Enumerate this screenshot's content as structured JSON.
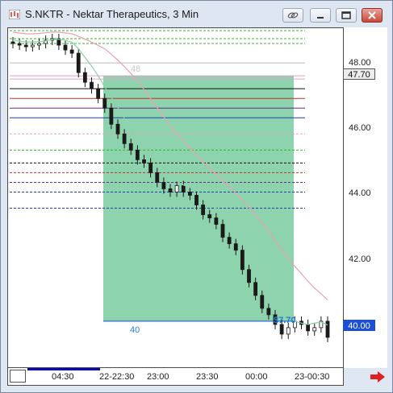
{
  "window": {
    "title": "S.NKTR - Nektar Therapeutics, 3 Min",
    "title_icon": "chart-app-icon",
    "buttons": [
      "link-icon",
      "minimize-icon",
      "restore-icon",
      "close-icon"
    ]
  },
  "price_axis": {
    "ticks": [
      "48.00",
      "46.00",
      "44.00",
      "42.00",
      "40.00"
    ],
    "last_price": "47.70",
    "low_marker": "40.00"
  },
  "time_axis": {
    "labels": [
      "04:30",
      "22-22:30",
      "23:00",
      "23:30",
      "00:00",
      "23-00:30"
    ]
  },
  "annotations": {
    "zone_top": "48",
    "zone_bottom": "40",
    "move_label": "$7.70"
  },
  "colors": {
    "zone_fill": "#5cc08a",
    "up_candle": "#1a1a1a",
    "down_candle": "#1a1a1a",
    "ma_slow": "#e8a0b4",
    "ma_fast": "#8fd1a8",
    "accent_blue": "#1d7fd6",
    "arrow_red": "#e02020"
  },
  "chart_data": {
    "type": "candlestick",
    "title": "S.NKTR - Nektar Therapeutics, 3 Min",
    "xlabel": "",
    "ylabel": "",
    "ylim": [
      38.6,
      49.0
    ],
    "x_labels": [
      "04:30",
      "22-22:30",
      "23:00",
      "23:30",
      "00:00",
      "23-00:30"
    ],
    "horizontal_lines": [
      49.0,
      48.75,
      48.6,
      48.0,
      47.6,
      47.5,
      47.2,
      46.9,
      46.6,
      46.3,
      45.8,
      45.3,
      44.9,
      44.6,
      44.3,
      44.0,
      43.5
    ],
    "highlight_zone": {
      "top": 47.6,
      "bottom": 40.0,
      "top_label": "48",
      "bottom_label": "40",
      "move": "$7.70"
    },
    "close_series": [
      48.6,
      48.55,
      48.5,
      48.55,
      48.6,
      48.7,
      48.75,
      48.55,
      48.4,
      48.3,
      47.7,
      47.4,
      47.2,
      46.9,
      46.6,
      46.1,
      45.8,
      45.5,
      45.3,
      45.0,
      44.9,
      44.6,
      44.3,
      44.1,
      44.0,
      44.2,
      44.0,
      43.9,
      43.6,
      43.3,
      43.2,
      43.0,
      42.6,
      42.4,
      42.2,
      41.6,
      41.2,
      40.8,
      40.4,
      40.2,
      39.9,
      39.6,
      39.8,
      40.0,
      39.9,
      39.7,
      39.8,
      40.0,
      39.5
    ]
  }
}
